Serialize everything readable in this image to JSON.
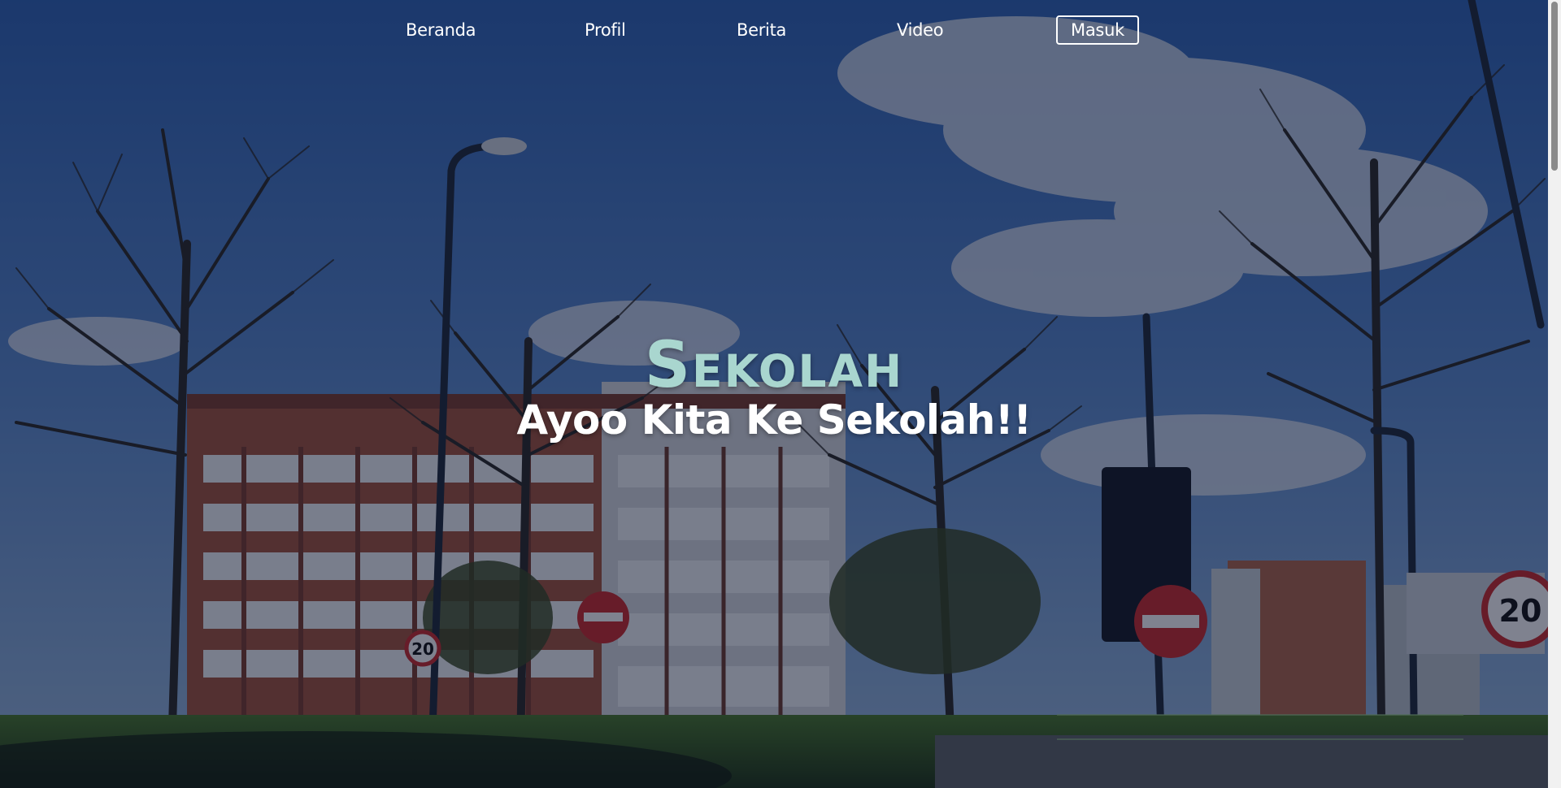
{
  "nav": {
    "items": [
      {
        "label": "Beranda"
      },
      {
        "label": "Profil"
      },
      {
        "label": "Berita"
      },
      {
        "label": "Video"
      }
    ],
    "login_label": "Masuk"
  },
  "hero": {
    "title": "Sekolah",
    "subtitle": "Ayoo Kita Ke Sekolah!!",
    "background_image": "school-building-photo",
    "title_color": "#a9d6cf",
    "text_color": "#ffffff"
  },
  "signs": {
    "speed_limit": "20"
  }
}
